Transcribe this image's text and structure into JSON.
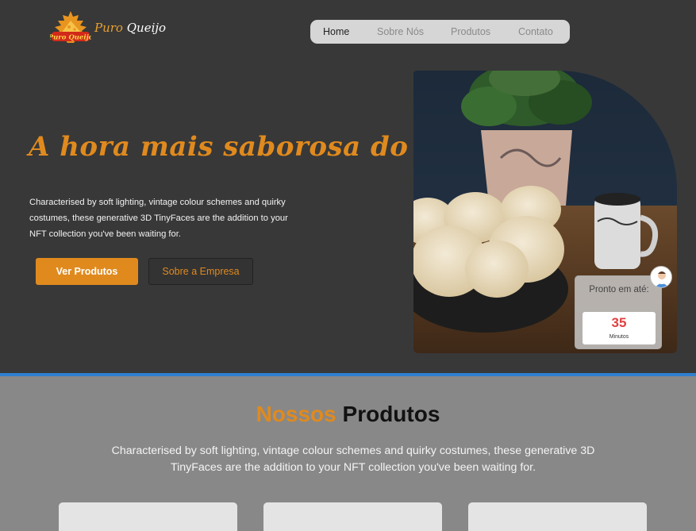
{
  "brand": {
    "badge_text": "Puro Queijo",
    "name_part1": "Puro",
    "name_part2": "Queijo"
  },
  "nav": {
    "items": [
      {
        "label": "Home",
        "active": true
      },
      {
        "label": "Sobre Nós",
        "active": false
      },
      {
        "label": "Produtos",
        "active": false
      },
      {
        "label": "Contato",
        "active": false
      }
    ]
  },
  "hero": {
    "title": "A hora mais saborosa do dia",
    "description": "Characterised by soft lighting, vintage colour schemes and quirky costumes, these generative 3D TinyFaces are the addition to your NFT collection you've been waiting for.",
    "primary_button": "Ver Produtos",
    "secondary_button": "Sobre  a Empresa"
  },
  "ready_card": {
    "label": "Pronto em até:",
    "value": "35",
    "unit": "Minutos"
  },
  "products": {
    "title_part1": "Nossos",
    "title_part2": "Produtos",
    "description": "Characterised by soft lighting, vintage colour schemes and quirky costumes, these generative 3D TinyFaces are the addition to your NFT collection you've been waiting for."
  },
  "colors": {
    "accent": "#e08a1e",
    "hero_bg": "#383838",
    "products_bg": "#888888",
    "divider": "#2f7fd0"
  }
}
